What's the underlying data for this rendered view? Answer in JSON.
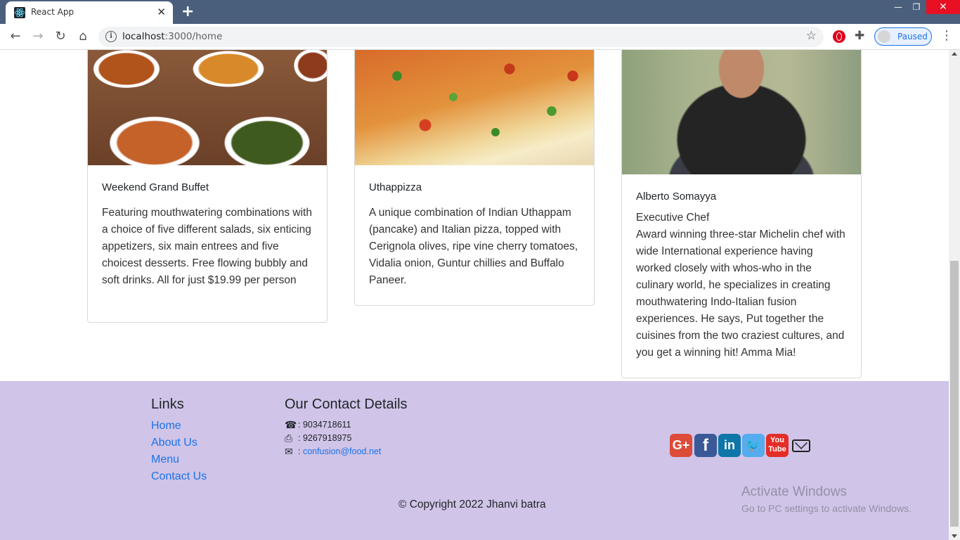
{
  "browser": {
    "tab_title": "React App",
    "url_host": "localhost",
    "url_path": ":3000/home",
    "profile_label": "Paused"
  },
  "cards": [
    {
      "title": "Weekend Grand Buffet",
      "description": "Featuring mouthwatering combinations with a choice of five different salads, six enticing appetizers, six main entrees and five choicest desserts. Free flowing bubbly and soft drinks. All for just $19.99 per person"
    },
    {
      "title": "Uthappizza",
      "description": "A unique combination of Indian Uthappam (pancake) and Italian pizza, topped with Cerignola olives, ripe vine cherry tomatoes, Vidalia onion, Guntur chillies and Buffalo Paneer."
    },
    {
      "title": "Alberto Somayya",
      "subtitle": "Executive Chef",
      "description": "Award winning three-star Michelin chef with wide International experience having worked closely with whos-who in the culinary world, he specializes in creating mouthwatering Indo-Italian fusion experiences. He says, Put together the cuisines from the two craziest cultures, and you get a winning hit! Amma Mia!"
    }
  ],
  "footer": {
    "links_heading": "Links",
    "links": [
      "Home",
      "About Us",
      "Menu",
      "Contact Us"
    ],
    "contact_heading": "Our Contact Details",
    "phone": ": 9034718611",
    "fax": ": 9267918975",
    "email_prefix": ":",
    "email": "confusion@food.net",
    "social_icons": [
      "google-plus-icon",
      "facebook-icon",
      "linkedin-icon",
      "twitter-icon",
      "youtube-icon",
      "mail-icon"
    ],
    "copyright": "© Copyright 2022 Jhanvi batra"
  },
  "watermark": {
    "title": "Activate Windows",
    "subtitle": "Go to PC settings to activate Windows."
  },
  "colors": {
    "footer_bg": "#d0c4e8",
    "link": "#1a73e8",
    "tabstrip": "#4a5f7c"
  }
}
